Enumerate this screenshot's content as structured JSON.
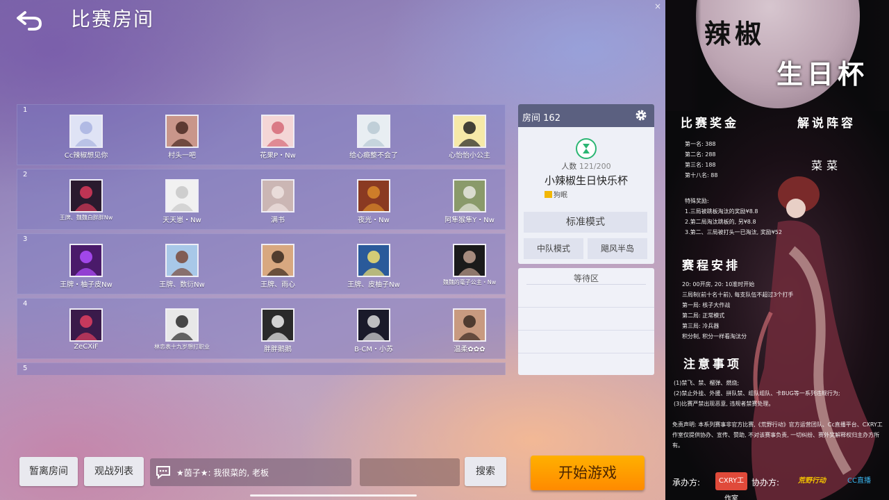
{
  "header": {
    "title": "比赛房间"
  },
  "teams": [
    {
      "number": "1",
      "players": [
        {
          "name": "Cc辣椒想见你",
          "avatar_color": "#dfe3f5",
          "accent": "#a9b3e0",
          "small": false
        },
        {
          "name": "村头一吧",
          "avatar_color": "#c9968a",
          "accent": "#4a2a22",
          "small": false
        },
        {
          "name": "花果P・Nw",
          "avatar_color": "#f4d6d6",
          "accent": "#d56a78",
          "small": false
        },
        {
          "name": "给心瘾整不会了",
          "avatar_color": "#e8eef2",
          "accent": "#b8c9d4",
          "small": false
        },
        {
          "name": "心怡怡小公主",
          "avatar_color": "#f6e9a8",
          "accent": "#222222",
          "small": false
        }
      ]
    },
    {
      "number": "2",
      "players": [
        {
          "name": "王牌、魏魏白胖胖Nw",
          "avatar_color": "#2a1a2e",
          "accent": "#d93a5a",
          "small": true
        },
        {
          "name": "天天崽・Nw",
          "avatar_color": "#f1f1f1",
          "accent": "#c8c8c8",
          "small": false
        },
        {
          "name": "满书",
          "avatar_color": "#cbb6b4",
          "accent": "#efe3e0",
          "small": false
        },
        {
          "name": "夜光・Nw",
          "avatar_color": "#8a3a22",
          "accent": "#d98a2a",
          "small": false
        },
        {
          "name": "阿隼猴隼Y・Nw",
          "avatar_color": "#8a9a6a",
          "accent": "#e8e8e0",
          "small": false
        }
      ]
    },
    {
      "number": "3",
      "players": [
        {
          "name": "王牌・柚子皮Nw",
          "avatar_color": "#4a1a6a",
          "accent": "#b050ff",
          "small": false
        },
        {
          "name": "王牌、数衍Nw",
          "avatar_color": "#a8c8e8",
          "accent": "#7a4a3a",
          "small": false
        },
        {
          "name": "王牌、雨心",
          "avatar_color": "#d8a880",
          "accent": "#3a2a20",
          "small": false
        },
        {
          "name": "王牌、皮柚子Nw",
          "avatar_color": "#2a5a9a",
          "accent": "#f2e070",
          "small": false
        },
        {
          "name": "魏魏的毫子公主・Nw",
          "avatar_color": "#1a1a1a",
          "accent": "#c0a090",
          "small": true
        }
      ]
    },
    {
      "number": "4",
      "players": [
        {
          "name": "ZeCXiF",
          "avatar_color": "#3a1a4a",
          "accent": "#e04060",
          "small": false
        },
        {
          "name": "林恋表十九岁想打职业",
          "avatar_color": "#e8e8e8",
          "accent": "#2a2a2a",
          "small": true
        },
        {
          "name": "胖胖鹅鹅",
          "avatar_color": "#2a2a2a",
          "accent": "#f0f0f0",
          "small": false
        },
        {
          "name": "B-CM・小苏",
          "avatar_color": "#1a1a2a",
          "accent": "#dcdcdc",
          "small": false
        },
        {
          "name": "温柔✿✿✿",
          "avatar_color": "#c89a80",
          "accent": "#3a2a22",
          "small": false
        }
      ]
    },
    {
      "number": "5",
      "players": []
    }
  ],
  "room": {
    "label": "房间",
    "id": "162",
    "people_label": "人数",
    "people_count": "121/200",
    "name": "小辣椒生日快乐杯",
    "owner": "狗眠",
    "mode": "标准模式",
    "submode_left": "中队模式",
    "submode_right": "飓风半岛"
  },
  "waiting": {
    "title": "等待区"
  },
  "bottom": {
    "leave_label": "暂离房间",
    "spectate_label": "观战列表",
    "chat_message": "★茵子★: 我很菜的, 老板",
    "search_placeholder": "",
    "search_label": "搜索",
    "start_label": "开始游戏"
  },
  "poster": {
    "title_line1": "辣椒",
    "title_line2": "生日杯",
    "prize_heading": "比赛奖金",
    "commentary_heading": "解说阵容",
    "prizes": [
      "第一名: 388",
      "第二名: 288",
      "第三名: 188",
      "第十八名: 88"
    ],
    "commentator": "菜菜",
    "special_heading": "特殊奖励:",
    "special": [
      "1.三局被跳板淘汰的奖励¥8.8",
      "2.第二局淘汰跳板的, 另¥8.8",
      "3.第二、三局被打头一已淘汰, 奖励¥52"
    ],
    "schedule_heading": "赛程安排",
    "schedule": [
      "20: 00开房, 20: 10准时开始",
      "三局制(前十名十前), 每支队伍不超过3个打手",
      "第一局: 核子大作战",
      "第二局: 正常模式",
      "第三局: 冷兵器",
      "积分制, 积分一样看淘汰分"
    ],
    "notes_heading": "注意事项",
    "notes": [
      "(1)禁飞、禁、榴弹、燃烧;",
      "(2)禁止外挂、外援、拼队禁、组队组队、卡BUG等一系列违规行为;",
      "(3)比赛严禁出现恶意, 违规者禁赛处理。"
    ],
    "disclaimer": "免责声明: 本系列赛事非官方比赛,《荒野行动》官方运营团队、Cc直播平台、CXRY工作室仅提供协办、宣传、赞助, 不对该赛事负责, 一切纠纷、赛外奖解释权归主办方所有。",
    "organizer_label": "承办方:",
    "co_label": "协办方:",
    "sponsor1": "CXRY工作室",
    "sponsor2": "荒野行动",
    "sponsor3": "CC直播"
  }
}
